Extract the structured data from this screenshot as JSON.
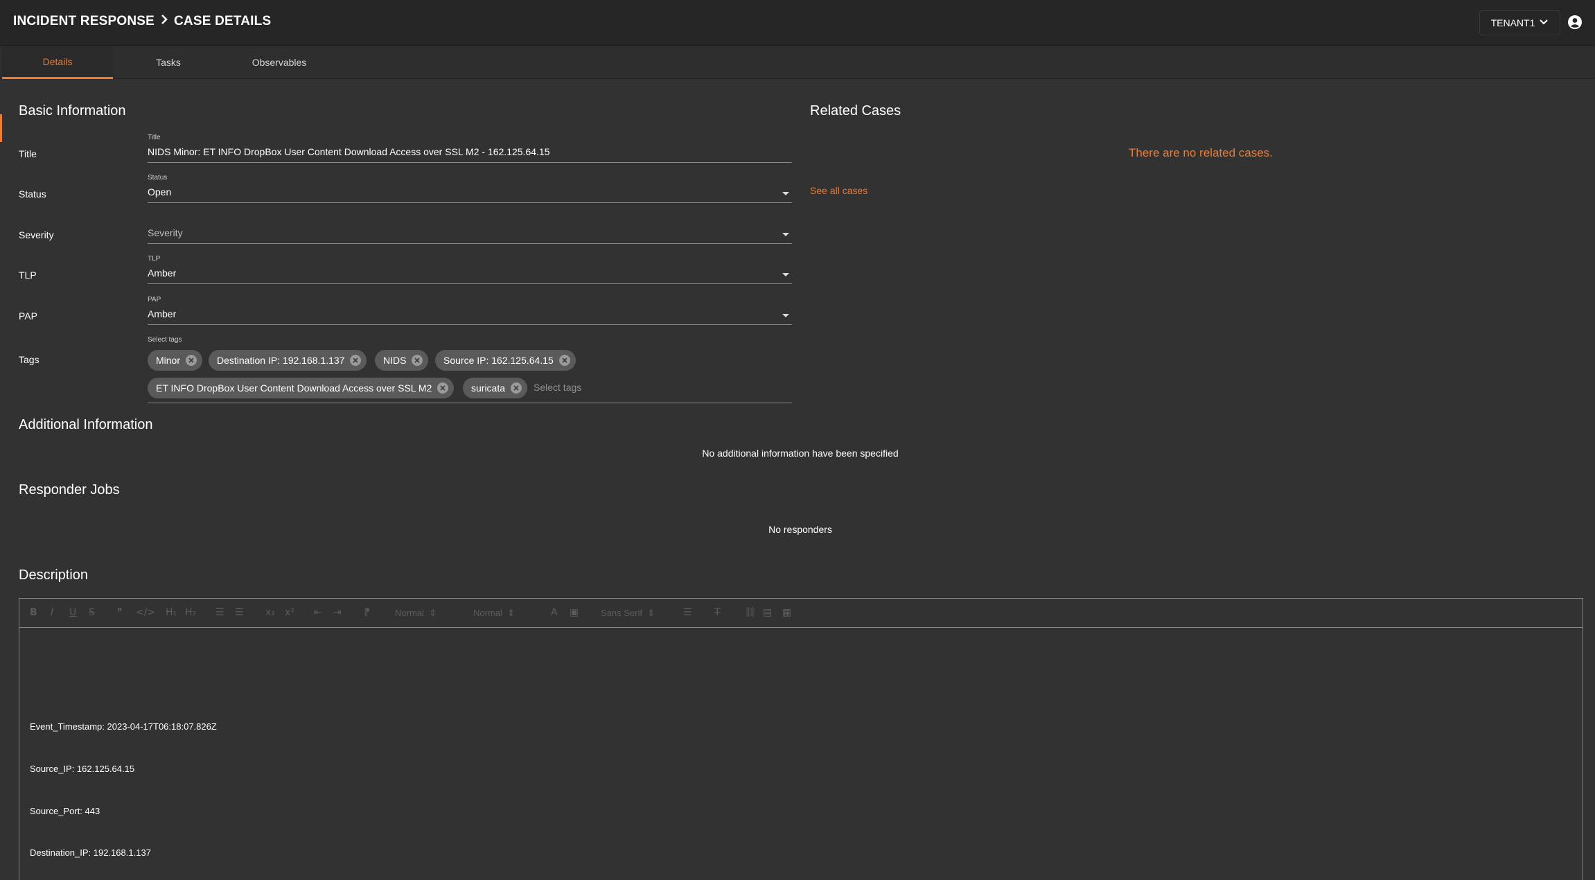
{
  "header": {
    "breadcrumb_root": "INCIDENT RESPONSE",
    "breadcrumb_current": "CASE DETAILS",
    "tenant": "TENANT1"
  },
  "tabs": [
    {
      "label": "Details",
      "active": true
    },
    {
      "label": "Tasks",
      "active": false
    },
    {
      "label": "Observables",
      "active": false
    }
  ],
  "basic_info": {
    "heading": "Basic Information",
    "title": {
      "label": "Title",
      "floating": "Title",
      "value": "NIDS Minor: ET INFO DropBox User Content Download Access over SSL M2 - 162.125.64.15"
    },
    "status": {
      "label": "Status",
      "floating": "Status",
      "value": "Open"
    },
    "severity": {
      "label": "Severity",
      "placeholder": "Severity"
    },
    "tlp": {
      "label": "TLP",
      "floating": "TLP",
      "value": "Amber"
    },
    "pap": {
      "label": "PAP",
      "floating": "PAP",
      "value": "Amber"
    },
    "tags": {
      "label": "Tags",
      "floating": "Select tags",
      "placeholder": "Select tags",
      "items": [
        "Minor",
        "Destination IP: 192.168.1.137",
        "NIDS",
        "Source IP: 162.125.64.15",
        "ET INFO DropBox User Content Download Access over SSL M2",
        "suricata"
      ]
    }
  },
  "related_cases": {
    "heading": "Related Cases",
    "empty_message": "There are no related cases.",
    "see_all": "See all cases"
  },
  "additional_info": {
    "heading": "Additional Information",
    "empty_message": "No additional information have been specified"
  },
  "responder_jobs": {
    "heading": "Responder Jobs",
    "empty_message": "No responders"
  },
  "description": {
    "heading": "Description",
    "toolbar": {
      "header_select": "Normal",
      "size_select": "Normal",
      "font_select": "Sans Serif"
    },
    "lines": [
      "Event_Timestamp: 2023-04-17T06:18:07.826Z",
      "Source_IP: 162.125.64.15",
      "Source_Port: 443",
      "Destination_IP: 192.168.1.137"
    ]
  },
  "colors": {
    "accent": "#f07a2e",
    "background": "#323232",
    "topbar": "#262626"
  }
}
